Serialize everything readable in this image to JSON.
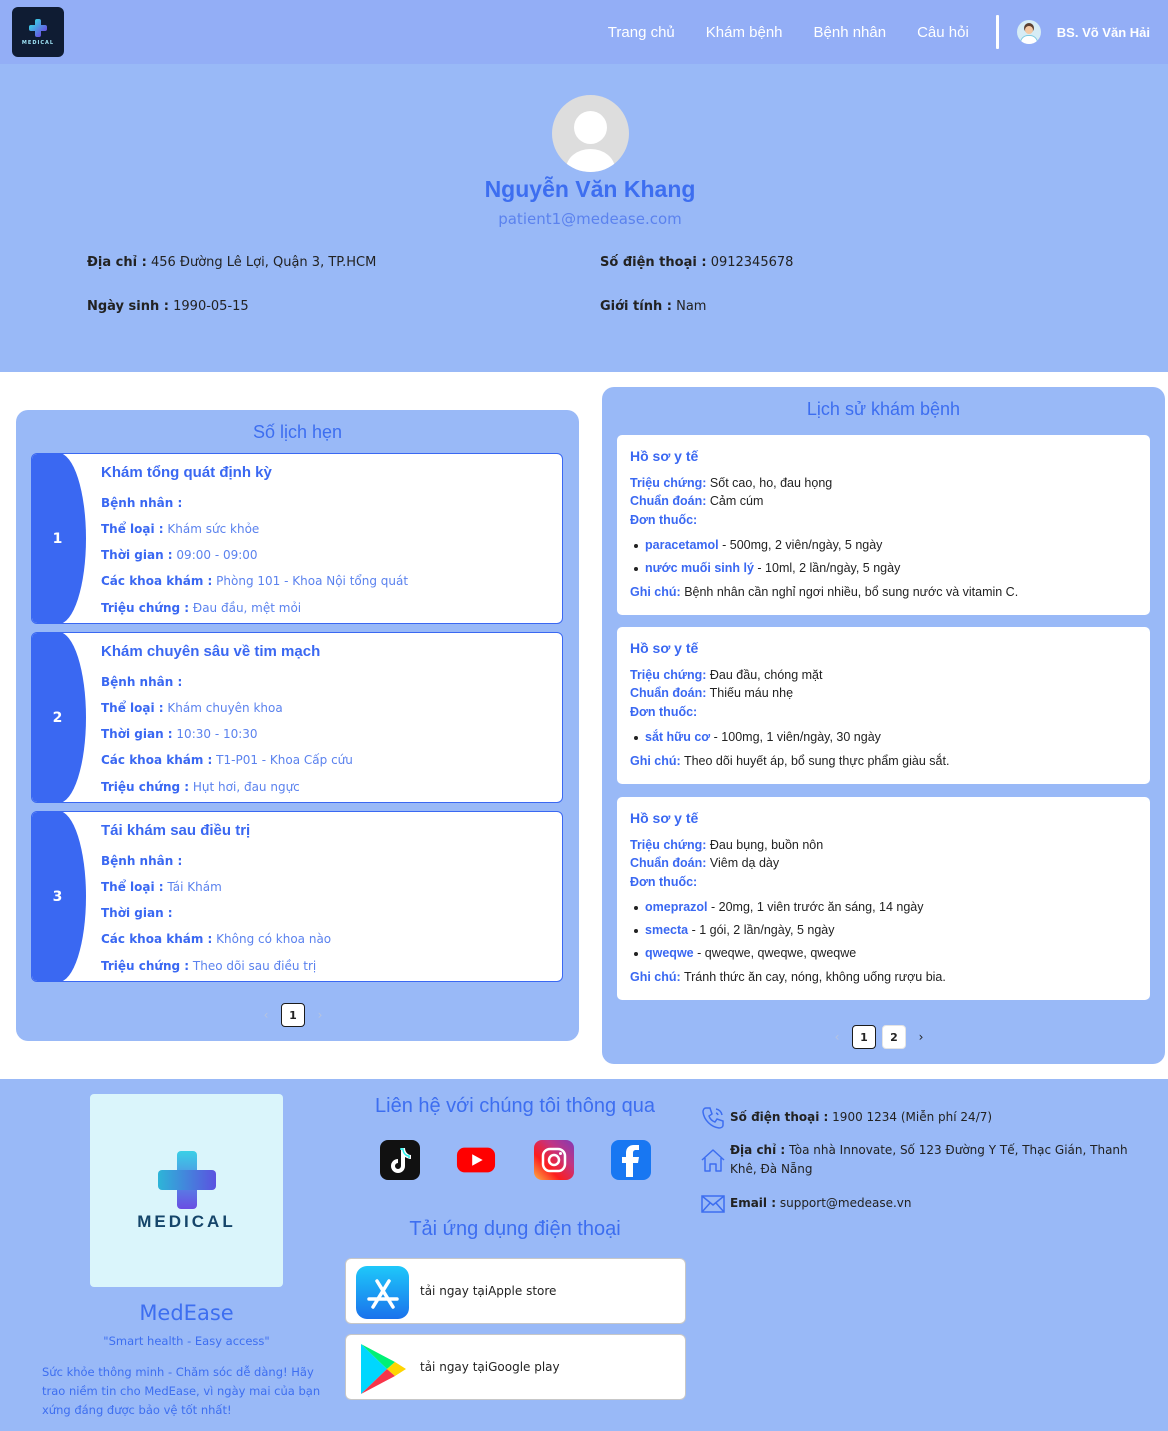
{
  "header": {
    "nav": [
      "Trang chủ",
      "Khám bệnh",
      "Bệnh nhân",
      "Câu hỏi"
    ],
    "user_name": "BS. Võ Văn Hải",
    "logo_text": "MEDICAL"
  },
  "profile": {
    "name": "Nguyễn Văn Khang",
    "email": "patient1@medease.com",
    "address_label": "Địa chỉ :",
    "address": "456 Đường Lê Lợi, Quận 3, TP.HCM",
    "phone_label": "Số điện thoại :",
    "phone": "0912345678",
    "dob_label": "Ngày sinh :",
    "dob": "1990-05-15",
    "gender_label": "Giới tính :",
    "gender": "Nam"
  },
  "appointments": {
    "title": "Số lịch hẹn",
    "labels": {
      "patient": "Bệnh nhân :",
      "type": "Thể loại :",
      "time": "Thời gian :",
      "dept": "Các khoa khám :",
      "symptom": "Triệu chứng :"
    },
    "items": [
      {
        "num": "1",
        "title": "Khám tổng quát định kỳ",
        "patient": "",
        "type": "Khám sức khỏe",
        "time": "09:00 - 09:00",
        "dept": "Phòng 101 - Khoa Nội tổng quát",
        "symptom": "Đau đầu, mệt mỏi"
      },
      {
        "num": "2",
        "title": "Khám chuyên sâu về tim mạch",
        "patient": "",
        "type": "Khám chuyên khoa",
        "time": "10:30 - 10:30",
        "dept": "T1-P01 - Khoa Cấp cứu",
        "symptom": "Hụt hơi, đau ngực"
      },
      {
        "num": "3",
        "title": "Tái khám sau điều trị",
        "patient": "",
        "type": "Tái Khám",
        "time": "",
        "dept": "Không có khoa nào",
        "symptom": "Theo dõi sau điều trị"
      }
    ],
    "pager": {
      "prev": "‹",
      "page": "1",
      "next": "›"
    }
  },
  "history": {
    "title": "Lịch sử khám bệnh",
    "labels": {
      "record": "Hồ sơ y tế",
      "symptom": "Triệu chứng:",
      "diagnosis": "Chuẩn đoán:",
      "prescription": "Đơn thuốc:",
      "note": "Ghi chú:"
    },
    "records": [
      {
        "symptom": "Sốt cao, ho, đau họng",
        "diagnosis": "Cảm cúm",
        "meds": [
          {
            "name": "paracetamol",
            "detail": "- 500mg, 2 viên/ngày, 5 ngày"
          },
          {
            "name": "nước muối sinh lý",
            "detail": "- 10ml, 2 lần/ngày, 5 ngày"
          }
        ],
        "note": "Bệnh nhân cần nghỉ ngơi nhiều, bổ sung nước và vitamin C."
      },
      {
        "symptom": "Đau đầu, chóng mặt",
        "diagnosis": "Thiếu máu nhẹ",
        "meds": [
          {
            "name": "sắt hữu cơ",
            "detail": "- 100mg, 1 viên/ngày, 30 ngày"
          }
        ],
        "note": "Theo dõi huyết áp, bổ sung thực phẩm giàu sắt."
      },
      {
        "symptom": "Đau bụng, buồn nôn",
        "diagnosis": "Viêm dạ dày",
        "meds": [
          {
            "name": "omeprazol",
            "detail": "- 20mg, 1 viên trước ăn sáng, 14 ngày"
          },
          {
            "name": "smecta",
            "detail": "- 1 gói, 2 lần/ngày, 5 ngày"
          },
          {
            "name": "qweqwe",
            "detail": "- qweqwe, qweqwe, qweqwe"
          }
        ],
        "note": "Tránh thức ăn cay, nóng, không uống rượu bia."
      }
    ],
    "pager": {
      "prev": "‹",
      "pages": [
        "1",
        "2"
      ],
      "next": "›"
    }
  },
  "footer": {
    "logo_text": "MEDICAL",
    "brand": "MedEase",
    "slogan": "\"Smart health - Easy access\"",
    "description": "Sức khỏe thông minh - Chăm sóc dễ dàng! Hãy trao niềm tin cho MedEase, vì ngày mai của bạn xứng đáng được bảo vệ tốt nhất!",
    "contact_title": "Liên hệ với chúng tôi thông qua",
    "app_title": "Tải ứng dụng điện thoại",
    "apple": "tải ngay tạiApple store",
    "google": "tải ngay tạiGoogle play",
    "phone_label": "Số điện thoại :",
    "phone": "1900 1234 (Miễn phí 24/7)",
    "address_label": "Địa chỉ :",
    "address": "Tòa nhà Innovate, Số 123 Đường Y Tế, Thạc Gián, Thanh Khê, Đà Nẵng",
    "email_label": "Email :",
    "email": "support@medease.vn"
  },
  "colors": {
    "accent": "#3a68f2",
    "header_bg": "#93aef6",
    "panel_bg": "#99b9f7"
  }
}
